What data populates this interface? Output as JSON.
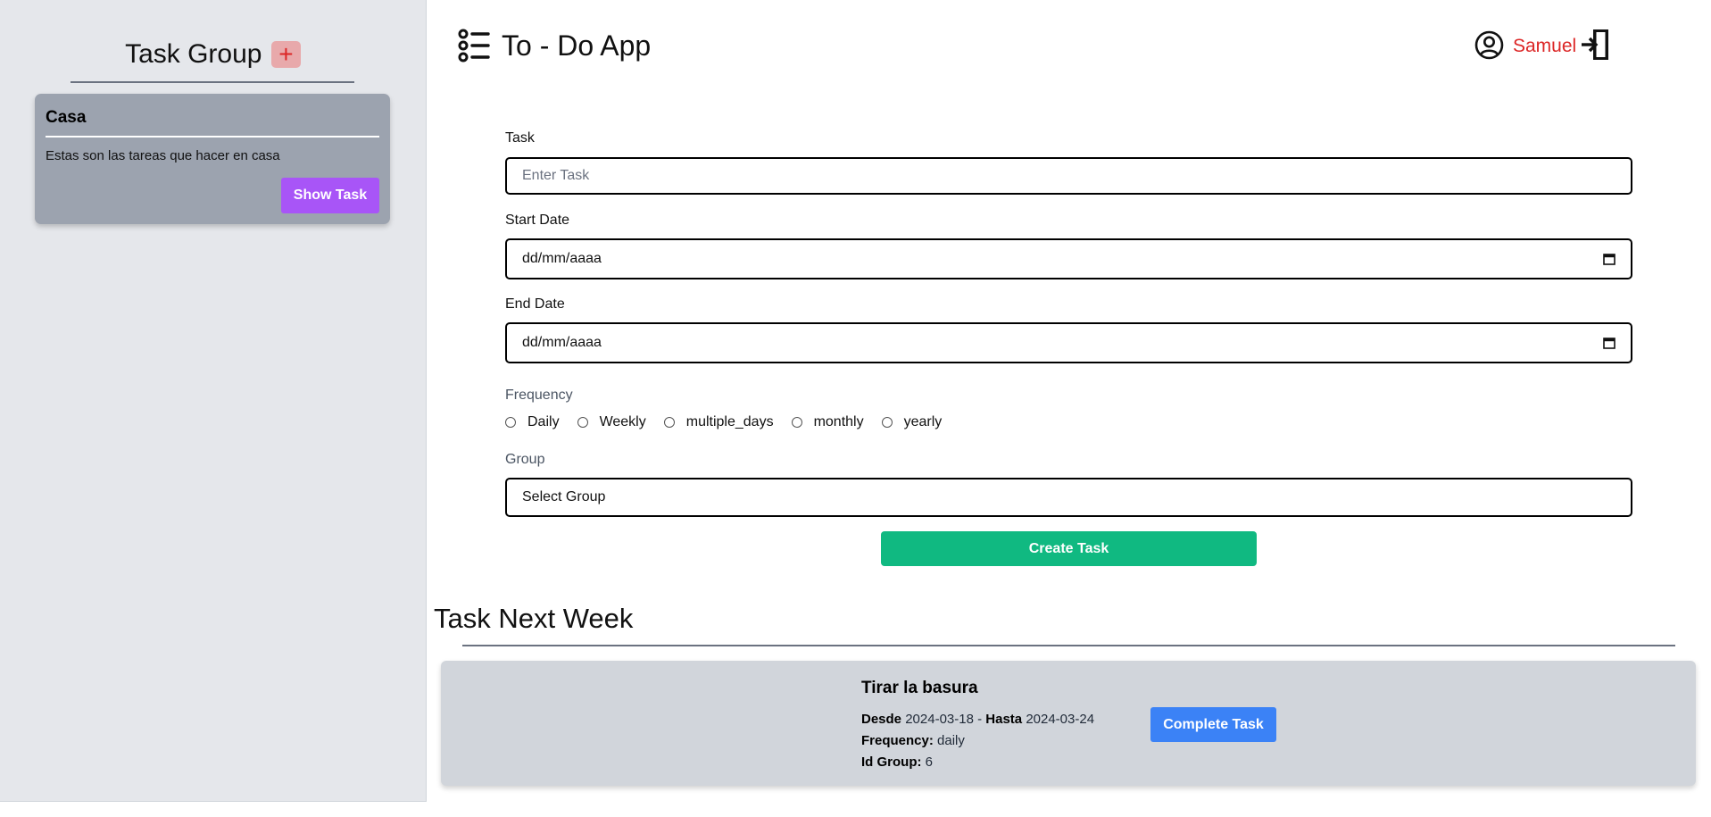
{
  "sidebar": {
    "title": "Task Group",
    "add_label": "+",
    "groups": [
      {
        "name": "Casa",
        "description": "Estas son las tareas que hacer en casa",
        "button_label": "Show Task"
      }
    ]
  },
  "header": {
    "app_title": "To - Do App",
    "app_icon": "list-icon",
    "user_name": "Samuel",
    "user_icon": "user-circle-icon",
    "logout_icon": "logout-icon"
  },
  "form": {
    "task_label": "Task",
    "task_placeholder": "Enter Task",
    "task_value": "",
    "start_label": "Start Date",
    "start_value": "dd/mm/aaaa",
    "end_label": "End Date",
    "end_value": "dd/mm/aaaa",
    "frequency_label": "Frequency",
    "frequency_options": [
      "Daily",
      "Weekly",
      "multiple_days",
      "monthly",
      "yearly"
    ],
    "group_label": "Group",
    "group_value": "Select Group",
    "submit_label": "Create Task"
  },
  "next_week": {
    "title": "Task Next Week",
    "tasks": [
      {
        "title": "Tirar la basura",
        "from_label": "Desde",
        "from": "2024-03-18",
        "separator": "-",
        "to_label": "Hasta",
        "to": "2024-03-24",
        "frequency_label": "Frequency:",
        "frequency": "daily",
        "group_label": "Id Group:",
        "group": "6",
        "button_label": "Complete Task"
      }
    ]
  },
  "colors": {
    "sidebar_bg": "#e5e7eb",
    "card_bg": "#9ca3af",
    "show_task": "#a855f7",
    "create_task": "#10b981",
    "complete_task": "#3b82f6",
    "user_name": "#dc2626",
    "task_card_bg": "#d1d5db"
  }
}
